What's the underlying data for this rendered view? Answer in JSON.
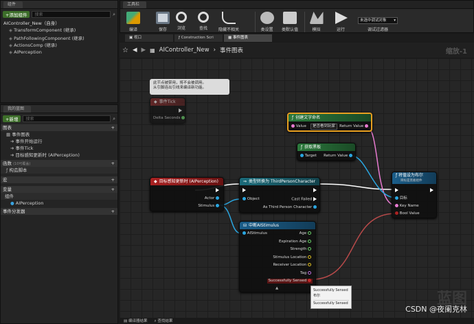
{
  "components": {
    "tab": "组件",
    "add_button": "+添加组件",
    "search_placeholder": "搜索",
    "root": "AIController_New（自身）",
    "items": [
      "TransformComponent (继承)",
      "PathFollowingComponent (继承)",
      "ActionsComp (继承)",
      "AIPerception"
    ]
  },
  "toolbar": {
    "tab": "工具栏",
    "buttons": [
      "编译",
      "保存",
      "浏览",
      "查找",
      "隐藏不相关",
      "类设置",
      "类默认值",
      "模拟",
      "运行"
    ],
    "debug_select": "未选中调试对象",
    "debug_label": "调试过滤器"
  },
  "doc_tabs": [
    "视口",
    "Construction Scri",
    "事件图表"
  ],
  "breadcrumb": {
    "class": "AIController_New",
    "sep": "›",
    "graph": "事件图表",
    "zoom": "缩放-1"
  },
  "myblueprint": {
    "tab": "我的蓝图",
    "add_button": "+新增",
    "search_placeholder": "搜索",
    "sections": {
      "graphs": "图表",
      "event_graph": "事件图表",
      "events": [
        "事件开始运行",
        "事件Tick",
        "目标感知更新时 (AIPerception)"
      ],
      "functions": "函数",
      "functions_hint": "(10可覆盖)",
      "construct": "构造脚本",
      "macros": "宏",
      "variables": "变量",
      "components": "组件",
      "var_item": "AIPerception",
      "dispatchers": "事件分发器"
    }
  },
  "graph": {
    "comment": [
      "此节点被禁用，将不会被调用。",
      "从引脚连出引线来编译新功能。"
    ],
    "tick_node": {
      "title": "事件Tick",
      "pin": "Delta Seconds"
    },
    "perception_node": {
      "title": "目标感知更新时 (AIPerception)",
      "pins": [
        "Actor",
        "Stimulus"
      ]
    },
    "cast_node": {
      "title": "类型转换为 ThirdPersonCharacter",
      "pins_in": [
        "Object"
      ],
      "pins_out": [
        "Cast Failed",
        "As Third Person Character"
      ]
    },
    "make_text_node": {
      "title": "创建文字命名",
      "value_label": "Value",
      "value": "是否看到玩家",
      "ret": "Return Value"
    },
    "get_blackboard_node": {
      "title": "获取黑板",
      "target": "Target",
      "ret": "Return Value"
    },
    "set_bool_node": {
      "title": "将值设为布尔",
      "subtitle": "目标是黑板组件",
      "pins": [
        "目标",
        "Key Name",
        "Bool Value"
      ]
    },
    "break_node": {
      "title": "中断AIStimulus",
      "in": "AIStimulus",
      "outs": [
        "Age",
        "Expiration Age",
        "Strength",
        "Stimulus Location",
        "Receiver Location",
        "Tag",
        "Successfully Sensed"
      ]
    },
    "tooltip": [
      "Successfully Sensed",
      "布尔",
      "Successfully Sensed"
    ]
  },
  "bottom_tabs": [
    "编译器结果",
    "查找结果"
  ],
  "watermark": [
    "CSDN @夜阑克林",
    "蓝图"
  ]
}
